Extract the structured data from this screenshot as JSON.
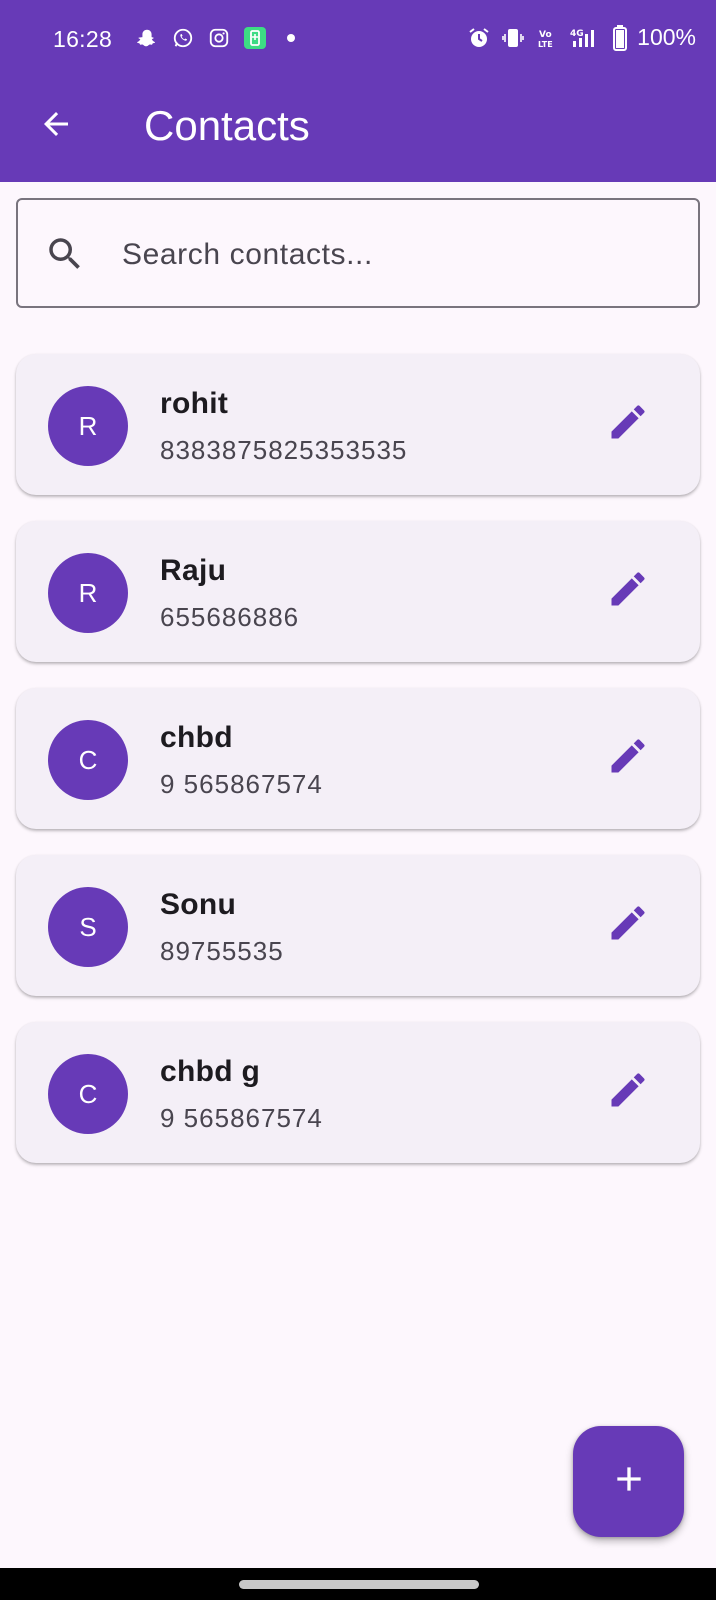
{
  "status_bar": {
    "time": "16:28",
    "battery": "100%",
    "left_icons": [
      "snapchat-icon",
      "whatsapp-icon",
      "instagram-icon",
      "battery-saver-icon",
      "dot-icon"
    ],
    "right_icons": [
      "alarm-icon",
      "vibrate-icon",
      "volte-icon",
      "signal-4g-icon",
      "battery-icon"
    ]
  },
  "app_bar": {
    "title": "Contacts",
    "back_icon": "arrow-back-icon"
  },
  "search": {
    "placeholder": "Search contacts...",
    "value": ""
  },
  "contacts": [
    {
      "initial": "R",
      "name": "rohit",
      "phone": "8383875825353535"
    },
    {
      "initial": "R",
      "name": "Raju",
      "phone": "655686886"
    },
    {
      "initial": "C",
      "name": "chbd",
      "phone": "9 565867574"
    },
    {
      "initial": "S",
      "name": "Sonu",
      "phone": "89755535"
    },
    {
      "initial": "C",
      "name": "chbd g",
      "phone": "9 565867574"
    }
  ],
  "fab": {
    "icon": "add-icon"
  },
  "colors": {
    "primary": "#673ab7",
    "background": "#fdf7fd",
    "card": "#f4eff7"
  }
}
